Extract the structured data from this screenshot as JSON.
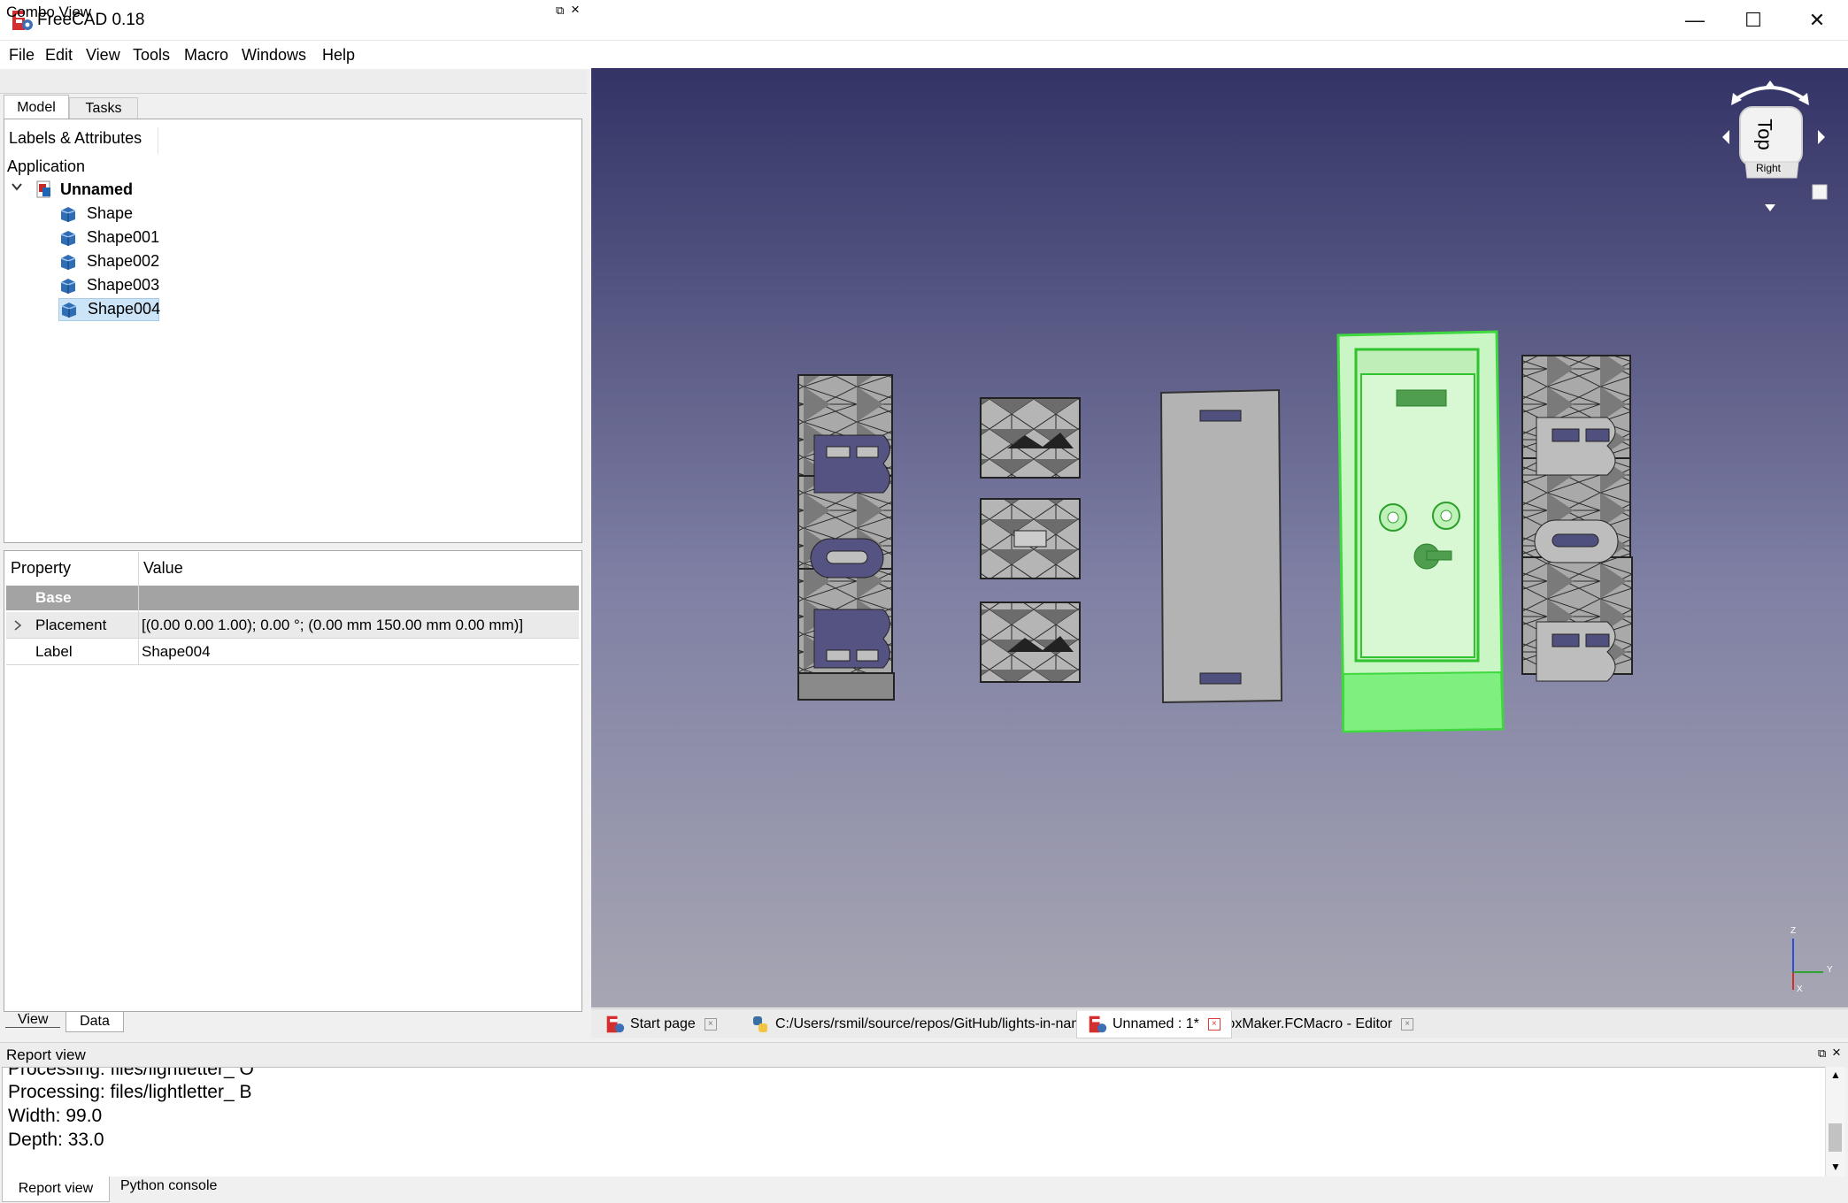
{
  "window": {
    "title": "FreeCAD 0.18",
    "min_glyph": "—",
    "max_glyph": "☐",
    "close_glyph": "✕"
  },
  "menu": [
    "File",
    "Edit",
    "View",
    "Tools",
    "Macro",
    "Windows",
    "Help"
  ],
  "combo_view": {
    "title": "Combo View",
    "tabs": [
      "Model",
      "Tasks"
    ],
    "tree_header": "Labels & Attributes",
    "app_label": "Application",
    "root": "Unnamed",
    "items": [
      "Shape",
      "Shape001",
      "Shape002",
      "Shape003",
      "Shape004"
    ],
    "selected_item": "Shape004"
  },
  "properties": {
    "col_property": "Property",
    "col_value": "Value",
    "group": "Base",
    "rows": [
      {
        "name": "Placement",
        "value": "[(0.00 0.00 1.00); 0.00 °; (0.00 mm  150.00 mm  0.00 mm)]"
      },
      {
        "name": "Label",
        "value": "Shape004"
      }
    ],
    "tabs": [
      "View",
      "Data"
    ]
  },
  "navcube": {
    "top": "Top",
    "right": "Right"
  },
  "axes": {
    "x": "X",
    "y": "Y",
    "z": "Z"
  },
  "document_tabs": [
    {
      "label": "Start page"
    },
    {
      "label": "C:/Users/rsmil/source/repos/GitHub/lights-in-names/box designer/LightBoxMaker.FCMacro - Editor"
    },
    {
      "label": "Unnamed : 1*"
    }
  ],
  "report": {
    "title": "Report view",
    "lines": [
      "Processing: files/lightletter_ O",
      "Processing: files/lightletter_ B",
      "Width: 99.0",
      "Depth: 33.0"
    ],
    "tabs": [
      "Report view",
      "Python console"
    ]
  },
  "colors": {
    "accent_selection": "#7ff27f",
    "viewport_top": "#333366",
    "viewport_bottom": "#a7a6b3"
  }
}
